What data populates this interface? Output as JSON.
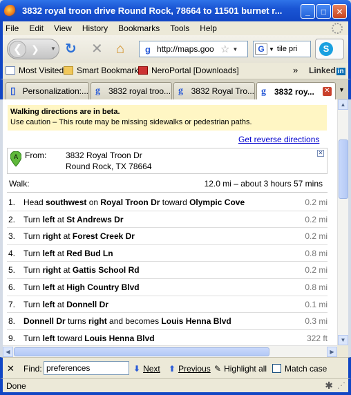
{
  "window": {
    "title": "3832 royal troon drive Round Rock, 78664 to 11501 burnet r...",
    "min_glyph": "_",
    "max_glyph": "□",
    "close_glyph": "✕"
  },
  "menu": [
    "File",
    "Edit",
    "View",
    "History",
    "Bookmarks",
    "Tools",
    "Help"
  ],
  "nav": {
    "back_glyph": "❮",
    "forward_glyph": "❯",
    "reload_glyph": "↻",
    "stop_glyph": "✕",
    "home_glyph": "⌂",
    "site_icon": "g",
    "url": "http://maps.goo",
    "search_engine_icon": "G",
    "search_text": "tile pri"
  },
  "bookmarks": {
    "items": [
      "Most Visited",
      "Smart Bookmarks",
      "NeroPortal [Downloads]"
    ],
    "overflow": "»",
    "linkedin": "Linked",
    "linkedin_in": "in"
  },
  "tabs": [
    {
      "label": "Personalization:...",
      "icon": "page"
    },
    {
      "label": "3832 royal troo...",
      "icon": "g"
    },
    {
      "label": "3832 Royal Tro...",
      "icon": "g"
    },
    {
      "label": "3832 roy...",
      "icon": "g",
      "active": true
    }
  ],
  "directions": {
    "beta_title": "Walking directions are in beta.",
    "beta_note": "Use caution – This route may be missing sidewalks or pedestrian paths.",
    "reverse_link": "Get reverse directions",
    "marker": "A",
    "from_label": "From:",
    "from_line1": "3832 Royal Troon Dr",
    "from_line2": "Round Rock, TX 78664",
    "walk_label": "Walk:",
    "walk_total": "12.0 mi – about 3 hours 57 mins",
    "steps": [
      {
        "num": "1.",
        "parts": [
          [
            "Head ",
            false
          ],
          [
            "southwest",
            true
          ],
          [
            " on ",
            false
          ],
          [
            "Royal Troon Dr",
            true
          ],
          [
            " toward ",
            false
          ],
          [
            "Olympic Cove",
            true
          ]
        ],
        "dist": "0.2 mi"
      },
      {
        "num": "2.",
        "parts": [
          [
            "Turn ",
            false
          ],
          [
            "left",
            true
          ],
          [
            " at ",
            false
          ],
          [
            "St Andrews Dr",
            true
          ]
        ],
        "dist": "0.2 mi"
      },
      {
        "num": "3.",
        "parts": [
          [
            "Turn ",
            false
          ],
          [
            "right",
            true
          ],
          [
            " at ",
            false
          ],
          [
            "Forest Creek Dr",
            true
          ]
        ],
        "dist": "0.2 mi"
      },
      {
        "num": "4.",
        "parts": [
          [
            "Turn ",
            false
          ],
          [
            "left",
            true
          ],
          [
            " at ",
            false
          ],
          [
            "Red Bud Ln",
            true
          ]
        ],
        "dist": "0.8 mi"
      },
      {
        "num": "5.",
        "parts": [
          [
            "Turn ",
            false
          ],
          [
            "right",
            true
          ],
          [
            " at ",
            false
          ],
          [
            "Gattis School Rd",
            true
          ]
        ],
        "dist": "0.2 mi"
      },
      {
        "num": "6.",
        "parts": [
          [
            "Turn ",
            false
          ],
          [
            "left",
            true
          ],
          [
            " at ",
            false
          ],
          [
            "High Country Blvd",
            true
          ]
        ],
        "dist": "0.8 mi"
      },
      {
        "num": "7.",
        "parts": [
          [
            "Turn ",
            false
          ],
          [
            "left",
            true
          ],
          [
            " at ",
            false
          ],
          [
            "Donnell Dr",
            true
          ]
        ],
        "dist": "0.1 mi"
      },
      {
        "num": "8.",
        "parts": [
          [
            "Donnell Dr",
            true
          ],
          [
            " turns ",
            false
          ],
          [
            "right",
            true
          ],
          [
            " and becomes ",
            false
          ],
          [
            "Louis Henna Blvd",
            true
          ]
        ],
        "dist": "0.3 mi"
      },
      {
        "num": "9.",
        "parts": [
          [
            "Turn ",
            false
          ],
          [
            "left",
            true
          ],
          [
            " toward ",
            false
          ],
          [
            "Louis Henna Blvd",
            true
          ]
        ],
        "dist": "322 ft"
      }
    ]
  },
  "findbar": {
    "close_glyph": "✕",
    "label": "Find:",
    "value": "preferences",
    "next": "Next",
    "previous": "Previous",
    "highlight": "Highlight all",
    "match_case": "Match case"
  },
  "status": {
    "text": "Done"
  }
}
